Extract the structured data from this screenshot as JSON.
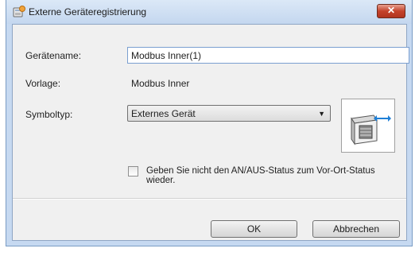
{
  "window": {
    "title": "Externe Geräteregistrierung",
    "close_label": "✕"
  },
  "form": {
    "device_name_label": "Gerätename:",
    "device_name_value": "Modbus Inner(1)",
    "template_label": "Vorlage:",
    "template_value": "Modbus Inner",
    "symbol_type_label": "Symboltyp:",
    "symbol_type_selected": "Externes Gerät",
    "checkbox_label": "Geben Sie nicht den AN/AUS-Status zum Vor-Ort-Status wieder.",
    "checkbox_checked": false
  },
  "buttons": {
    "ok_label": "OK",
    "cancel_label": "Abbrechen"
  },
  "colors": {
    "frame": "#c6d9f1",
    "client": "#f0f0f0",
    "accent_arrow": "#1e7fd6",
    "close_red": "#c4422b"
  },
  "icons": {
    "app": "device-register-icon",
    "preview": "external-device-icon"
  }
}
